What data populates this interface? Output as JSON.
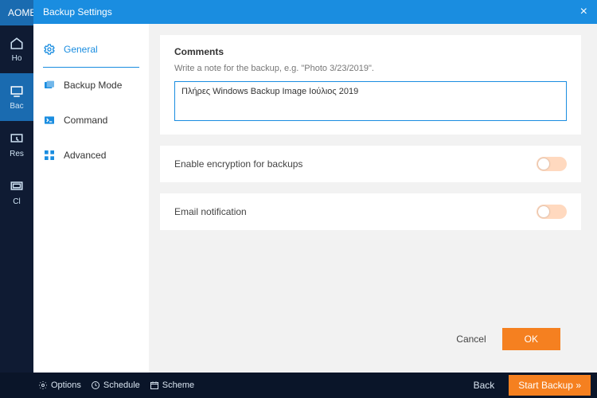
{
  "app": {
    "title": "AOMEI"
  },
  "nav": {
    "items": [
      "Ho",
      "Bac",
      "Res",
      "Cl"
    ],
    "active_index": 1
  },
  "modal": {
    "title": "Backup Settings",
    "sidebar": {
      "items": [
        {
          "label": "General"
        },
        {
          "label": "Backup Mode"
        },
        {
          "label": "Command"
        },
        {
          "label": "Advanced"
        }
      ],
      "active_index": 0
    },
    "comments": {
      "heading": "Comments",
      "helper": "Write a note for the backup, e.g. \"Photo 3/23/2019\".",
      "value": "Πλήρες Windows Backup Image Ιούλιος 2019"
    },
    "encryption": {
      "label": "Enable encryption for backups",
      "on": false
    },
    "email": {
      "label": "Email notification",
      "on": false
    },
    "footer": {
      "cancel": "Cancel",
      "ok": "OK"
    }
  },
  "bottombar": {
    "options": "Options",
    "schedule": "Schedule",
    "scheme": "Scheme",
    "back": "Back",
    "start": "Start Backup »"
  },
  "colors": {
    "accent": "#1a8de0",
    "orange": "#f58020"
  }
}
